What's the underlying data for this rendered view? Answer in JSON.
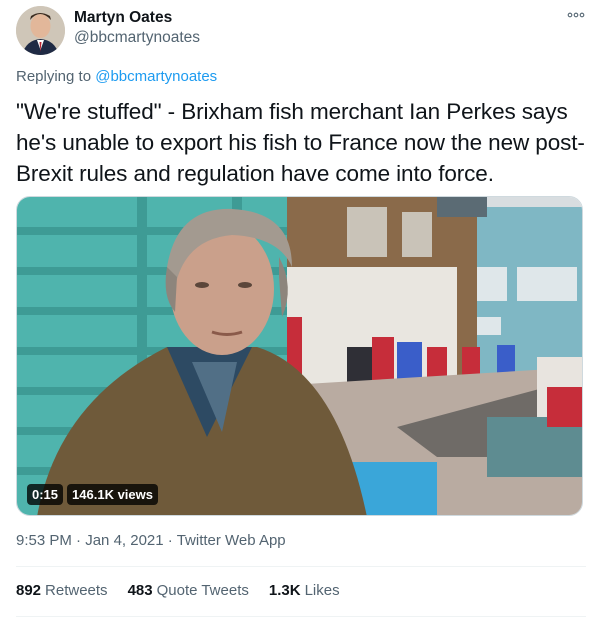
{
  "author": {
    "name": "Martyn Oates",
    "handle": "@bbcmartynoates"
  },
  "reply": {
    "prefix": "Replying to",
    "to": "@bbcmartynoates"
  },
  "tweet": {
    "text": "\"We're stuffed\" - Brixham fish merchant Ian Perkes says he's unable to export his fish to France now the new post-Brexit rules and regulation have come into force."
  },
  "video": {
    "duration": "0:15",
    "views": "146.1K views"
  },
  "meta": {
    "time": "9:53 PM",
    "separator1": "·",
    "date": "Jan 4, 2021",
    "separator2": "·",
    "source": "Twitter Web App"
  },
  "stats": {
    "retweets_count": "892",
    "retweets_label": "Retweets",
    "quotes_count": "483",
    "quotes_label": "Quote Tweets",
    "likes_count": "1.3K",
    "likes_label": "Likes"
  },
  "colors": {
    "link": "#1d9bf0",
    "secondary_text": "#536471",
    "primary_text": "#0f1419"
  },
  "icons": {
    "more": "more-dots-icon"
  }
}
